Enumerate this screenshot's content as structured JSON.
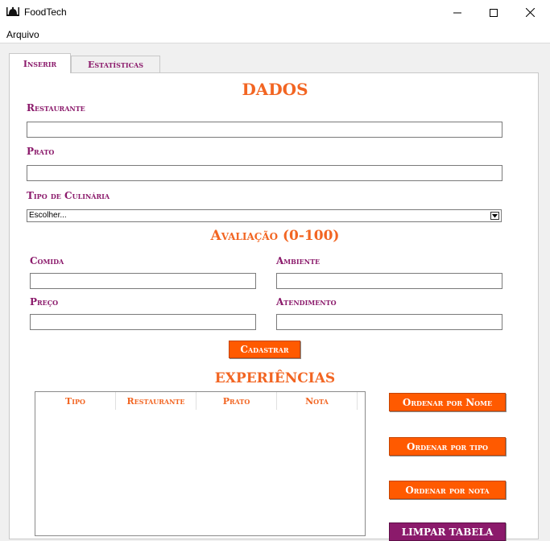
{
  "window": {
    "title": "FoodTech",
    "icon": "food-dome-icon"
  },
  "menu": {
    "arquivo": "Arquivo"
  },
  "tabs": [
    {
      "label": "Inserir"
    },
    {
      "label": "Estatísticas"
    }
  ],
  "dados": {
    "title": "DADOS",
    "restaurante_label": "Restaurante",
    "restaurante_value": "",
    "prato_label": "Prato",
    "prato_value": "",
    "tipo_label": "Tipo de Culinária",
    "tipo_selected": "Escolher..."
  },
  "avaliacao": {
    "title": "Avaliação (0-100)",
    "comida_label": "Comida",
    "ambiente_label": "Ambiente",
    "preco_label": "Preço",
    "atendimento_label": "Atendimento"
  },
  "cadastrar_label": "Cadastrar",
  "experiencias": {
    "title": "EXPERIÊNCIAS",
    "columns": [
      "Tipo",
      "Restaurante",
      "Prato",
      "Nota"
    ]
  },
  "buttons": {
    "ordenar_nome": "Ordenar por Nome",
    "ordenar_tipo": "Ordenar por tipo",
    "ordenar_nota": "Ordenar por nota",
    "limpar_tabela": "LIMPAR TABELA"
  },
  "colors": {
    "accent": "#f26522",
    "label": "#8b1a6b",
    "button": "#ff5a00"
  }
}
